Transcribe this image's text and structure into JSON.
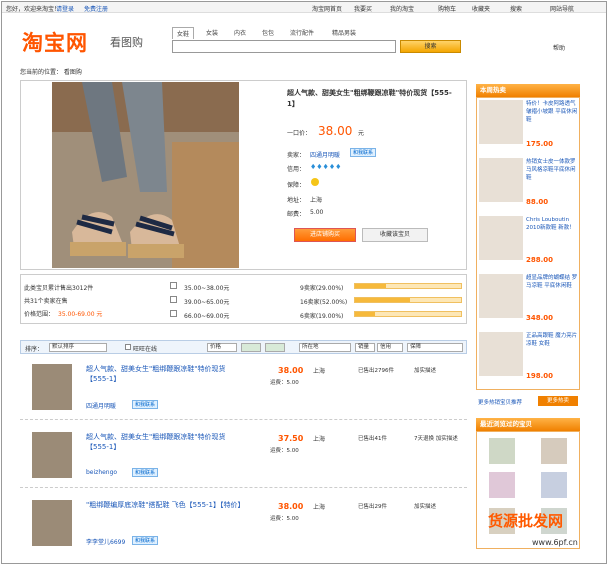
{
  "topbar": {
    "left": [
      "您好，欢迎来淘宝！",
      "请登录",
      "免费注册"
    ],
    "right": [
      "淘宝网首页",
      "我要买",
      "我的淘宝",
      "购物车",
      "收藏夹",
      "搜索",
      "网站导航"
    ]
  },
  "logo": {
    "brand": "淘宝网",
    "sub": "看图购"
  },
  "search": {
    "tabs": [
      "女鞋",
      "女装",
      "内衣",
      "包包",
      "流行配件",
      "精品男装"
    ],
    "active_tab": "女鞋",
    "value": "",
    "button": "搜索",
    "help": "帮助"
  },
  "breadcrumb": "您当前的位置： 看图购",
  "product": {
    "title": "超人气款、甜美女生\"粗绑鞭跟凉鞋\"特价现货【555-1】",
    "price_label": "一口价：",
    "price": "38.00",
    "price_unit": "元",
    "seller_label": "卖家：",
    "seller": "四通月明暖",
    "contact": "和我联系",
    "credit_label": "信用：",
    "credit_icons": "♦♦♦♦♦",
    "guarantee_label": "保障：",
    "location_label": "地址：",
    "location": "上海",
    "postage_label": "邮费：",
    "postage": "5.00",
    "buy_button": "进店铺购买",
    "fav_button": "收藏该宝贝"
  },
  "stats": {
    "sold_text": "此类宝贝累计售出3012件",
    "sellers_text": "共31个卖家在售",
    "range_label": "价格范围：",
    "range": "35.00-69.00 元",
    "ranges": [
      {
        "label": "35.00~38.00元",
        "count": "9卖家(29.00%)",
        "pct": 0.29
      },
      {
        "label": "39.00~65.00元",
        "count": "16卖家(52.00%)",
        "pct": 0.52
      },
      {
        "label": "66.00~69.00元",
        "count": "6卖家(19.00%)",
        "pct": 0.19
      }
    ]
  },
  "sortbar": {
    "sort_label": "排序：",
    "sort_value": "默认排序",
    "check_label": "旺旺在线",
    "price_label": "价格",
    "location_value": "所在地",
    "sales_value": "销量",
    "credit_value": "信用",
    "guarantee_value": "保障"
  },
  "items": [
    {
      "title": "超人气款、甜美女生\"粗绑鞭跟凉鞋\"特价现货【555-1】",
      "seller": "四通月明暖",
      "contact": "和我联系",
      "price": "38.00",
      "ship": "运费：5.00",
      "loc": "上海",
      "sold": "已售出2796件",
      "action": "加实描述"
    },
    {
      "title": "超人气款、甜美女生\"粗绑鞭跟凉鞋\"特价现货【555-1】",
      "seller": "beizhengo",
      "contact": "和我联系",
      "price": "37.50",
      "ship": "运费：5.00",
      "loc": "上海",
      "sold": "已售出41件",
      "action": "7天退换 加实描述"
    },
    {
      "title": "\"粗绑鞭编厚底凉鞋\"搭配鞋 飞色【555-1】【特价】",
      "seller": "李李堂儿6699",
      "contact": "和我联系",
      "price": "38.00",
      "ship": "运费：5.00",
      "loc": "上海",
      "sold": "已售出29件",
      "action": "加实描述"
    }
  ],
  "sidebar": {
    "hot_title": "本周热卖",
    "hot": [
      {
        "title": "特价！卡皮阿路透气皱褶小坡跟 平底休闲鞋",
        "price": "175.00"
      },
      {
        "title": "热销女士皮一体款罗马风格凉鞋平底休闲鞋",
        "price": "88.00"
      },
      {
        "title": "Chris Louboutin 2010新款鞋 新款！",
        "price": "288.00"
      },
      {
        "title": "超显品牌的蝴蝶结 罗马凉鞋 平底休闲鞋",
        "price": "348.00"
      },
      {
        "title": "正品高跟鞋 魔力亮片凉鞋 女鞋",
        "price": "198.00"
      }
    ],
    "more_link": "更多热销宝贝推荐",
    "more_btn": "更多热卖",
    "recent_title": "最近浏览过的宝贝"
  },
  "watermark": {
    "text": "货源批发网",
    "url": "www.6pf.cn"
  }
}
